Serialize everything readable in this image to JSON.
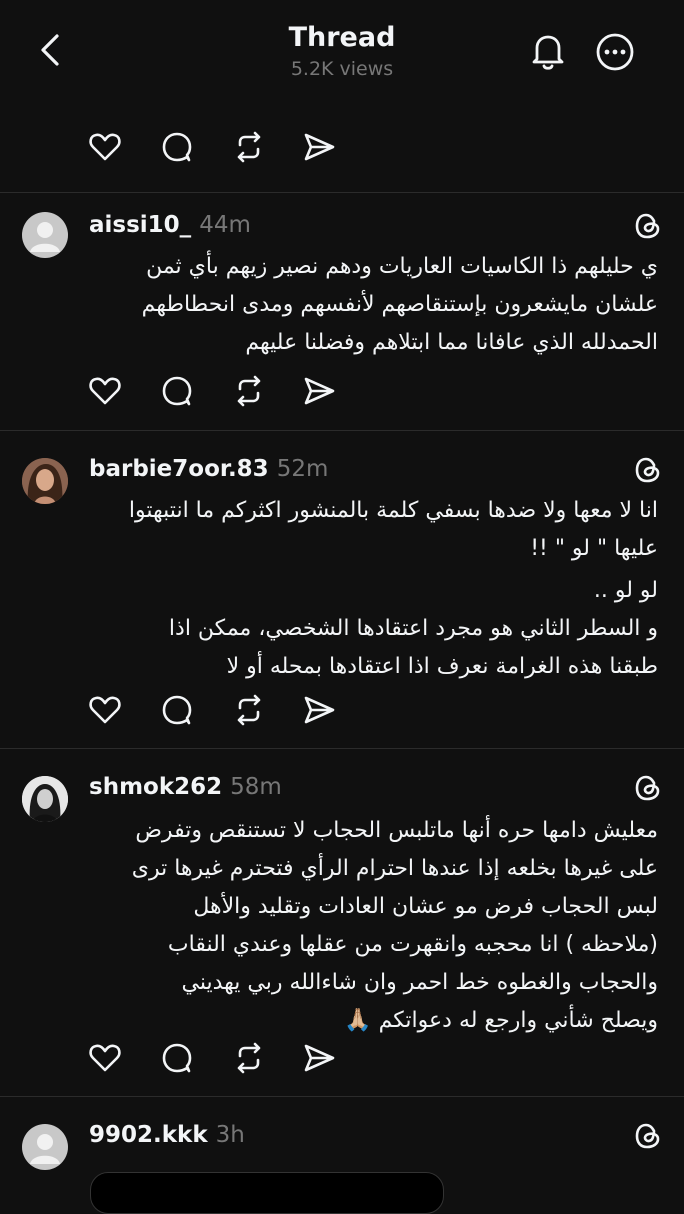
{
  "header": {
    "title": "Thread",
    "views": "5.2K views"
  },
  "posts": [
    {
      "username": "aissi10_",
      "time": "44m",
      "lines": [
        "ي حليلهم ذا الكاسيات العاريات ودهم نصير زيهم بأي ثمن",
        "علشان مايشعرون بإستنقاصهم لأنفسهم ومدى انحطاطهم",
        "الحمدلله الذي عافانا مما ابتلاهم وفضلنا عليهم"
      ]
    },
    {
      "username": "barbie7oor.83",
      "time": "52m",
      "lines": [
        "انا لا معها ولا ضدها بسفي كلمة بالمنشور اكثركم ما انتبهتوا",
        "عليها \" لو \" !!",
        "لو لو ..",
        "و السطر الثاني هو مجرد اعتقادها الشخصي، ممكن اذا",
        "طبقنا هذه الغرامة نعرف اذا اعتقادها بمحله أو  لا"
      ]
    },
    {
      "username": "shmok262",
      "time": "58m",
      "lines": [
        "معليش دامها حره أنها ماتلبس الحجاب لا تستنقص وتفرض",
        "على غيرها بخلعه إذا عندها احترام الرأي فتحترم غيرها ترى",
        "لبس الحجاب فرض مو عشان العادات وتقليد والأهل",
        "(ملاحظه ) انا محجبه وانقهرت من عقلها وعندي النقاب",
        "والحجاب والغطوه خط احمر وان شاءالله ربي يهديني",
        "ويصلح شأني وارجع له دعواتكم 🙏🏼"
      ]
    },
    {
      "username": "9902.kkk",
      "time": "3h",
      "lines": []
    }
  ]
}
